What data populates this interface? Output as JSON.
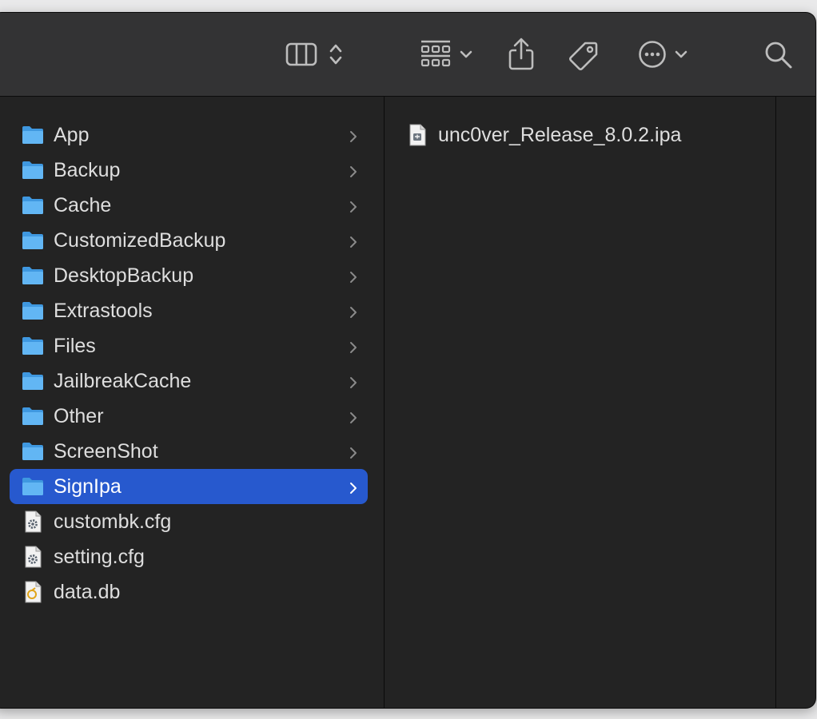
{
  "toolbar": {
    "view_icon": "column-view-icon",
    "view_stepper_icon": "up-down-chevron-icon",
    "group_icon": "grid-group-icon",
    "share_icon": "share-icon",
    "tag_icon": "tag-icon",
    "action_icon": "ellipsis-circle-icon",
    "search_icon": "search-icon"
  },
  "column1": {
    "items": [
      {
        "label": "App",
        "type": "folder"
      },
      {
        "label": "Backup",
        "type": "folder"
      },
      {
        "label": "Cache",
        "type": "folder"
      },
      {
        "label": "CustomizedBackup",
        "type": "folder"
      },
      {
        "label": "DesktopBackup",
        "type": "folder"
      },
      {
        "label": "Extrastools",
        "type": "folder"
      },
      {
        "label": "Files",
        "type": "folder"
      },
      {
        "label": "JailbreakCache",
        "type": "folder"
      },
      {
        "label": "Other",
        "type": "folder"
      },
      {
        "label": "ScreenShot",
        "type": "folder"
      },
      {
        "label": "SignIpa",
        "type": "folder",
        "selected": true
      },
      {
        "label": "custombk.cfg",
        "type": "config-file"
      },
      {
        "label": "setting.cfg",
        "type": "config-file"
      },
      {
        "label": "data.db",
        "type": "database-file"
      }
    ]
  },
  "column2": {
    "items": [
      {
        "label": "unc0ver_Release_8.0.2.ipa",
        "type": "ipa-file"
      }
    ]
  },
  "colors": {
    "window_bg": "#232323",
    "toolbar_bg": "#333334",
    "selection": "#2759ce",
    "folder_blue": "#5ab3f2",
    "text": "#dedede"
  }
}
